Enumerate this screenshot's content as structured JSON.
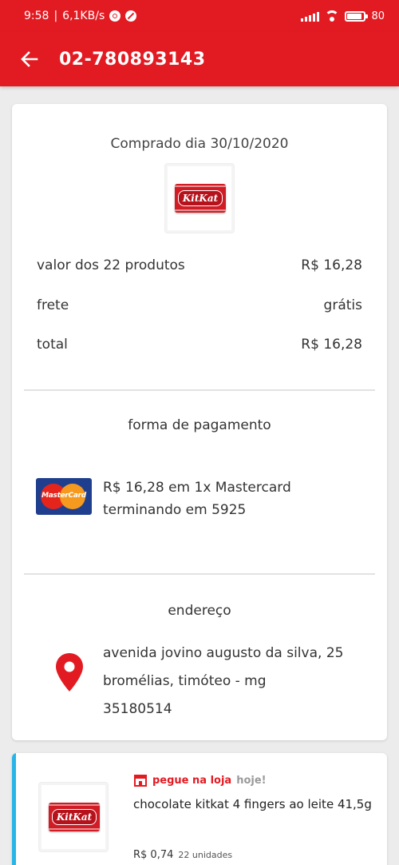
{
  "status_bar": {
    "time": "9:58",
    "speed": "6,1KB/s",
    "battery": "80"
  },
  "header": {
    "title": "02-780893143"
  },
  "order": {
    "purchased_label": "Comprado dia 30/10/2020",
    "product_image_label": "KitKat",
    "summary": [
      {
        "label": "valor dos 22 produtos",
        "value": "R$ 16,28"
      },
      {
        "label": "frete",
        "value": "grátis"
      },
      {
        "label": "total",
        "value": "R$ 16,28"
      }
    ],
    "payment": {
      "title": "forma de pagamento",
      "card_brand": "MasterCard",
      "line1": "R$ 16,28 em 1x Mastercard",
      "line2": "terminando em 5925"
    },
    "address": {
      "title": "endereço",
      "line1": "avenida jovino augusto da silva, 25",
      "line2": "bromélias, timóteo - mg",
      "line3": "35180514"
    }
  },
  "item": {
    "pickup_label": "pegue na loja",
    "pickup_when": "hoje!",
    "name": "chocolate kitkat 4 fingers ao leite 41,5g",
    "price": "R$ 0,74",
    "quantity": "22 unidades"
  },
  "colors": {
    "brand_red": "#e21b23",
    "accent_blue": "#27b5e8"
  }
}
